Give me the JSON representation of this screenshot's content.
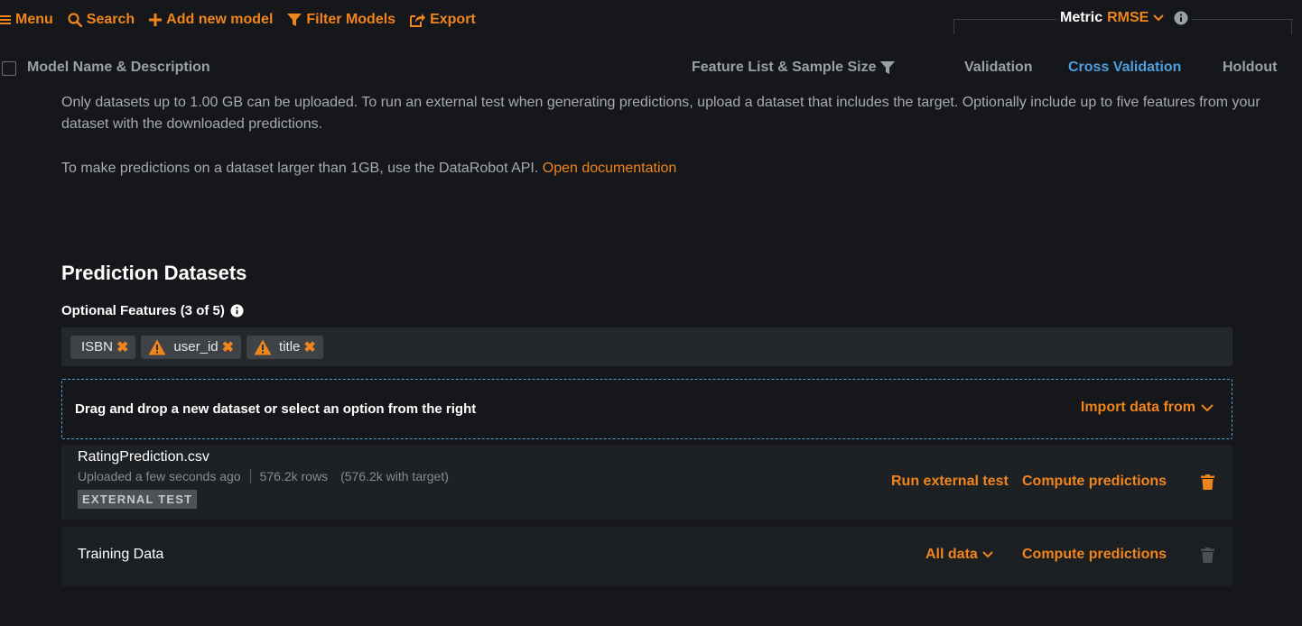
{
  "toolbar": {
    "menu_label": "Menu",
    "search_label": "Search",
    "add_model_label": "Add new model",
    "filter_label": "Filter Models",
    "export_label": "Export",
    "metric_label": "Metric",
    "metric_value": "RMSE"
  },
  "table_header": {
    "model_name": "Model Name & Description",
    "feature_list": "Feature List & Sample Size",
    "validation": "Validation",
    "cross_validation": "Cross Validation",
    "holdout": "Holdout"
  },
  "info": {
    "upload_limit": "Only datasets up to 1.00 GB can be uploaded. To run an external test when generating predictions, upload a dataset that includes the target. Optionally include up to five features from your dataset with the downloaded predictions.",
    "large_dataset": "To make predictions on a dataset larger than 1GB, use the DataRobot API.",
    "doc_link": "Open documentation"
  },
  "prediction_datasets": {
    "title": "Prediction Datasets",
    "optional_features_label": "Optional Features (3 of 5)",
    "features": [
      {
        "name": "ISBN",
        "warning": false
      },
      {
        "name": "user_id",
        "warning": true
      },
      {
        "name": "title",
        "warning": true
      }
    ],
    "dropzone_text": "Drag and drop a new dataset or select an option from the right",
    "import_label": "Import data from"
  },
  "datasets": [
    {
      "name": "RatingPrediction.csv",
      "uploaded": "Uploaded a few seconds ago",
      "rows": "576.2k rows",
      "with_target": "(576.2k with target)",
      "badge": "EXTERNAL TEST",
      "run_test_label": "Run external test",
      "compute_label": "Compute predictions"
    },
    {
      "name": "Training Data",
      "partition_label": "All data",
      "compute_label": "Compute predictions"
    }
  ],
  "colors": {
    "accent": "#f0851e",
    "active_tab": "#4d9fe0",
    "background": "#15171a"
  }
}
